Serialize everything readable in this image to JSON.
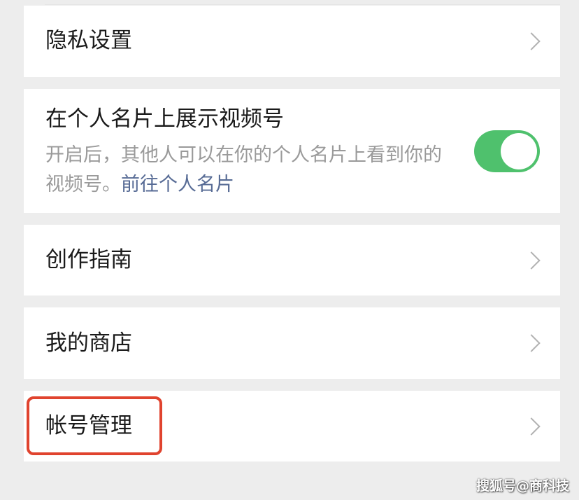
{
  "settings": {
    "privacy": {
      "label": "隐私设置"
    },
    "show_on_card": {
      "label": "在个人名片上展示视频号",
      "description": "开启后，其他人可以在你的个人名片上看到你的视频号。",
      "link": "前往个人名片",
      "enabled": true
    },
    "creation_guide": {
      "label": "创作指南"
    },
    "my_store": {
      "label": "我的商店"
    },
    "account_management": {
      "label": "帐号管理"
    }
  },
  "watermark": "搜狐号@商科技",
  "colors": {
    "toggle_on": "#4fc16d",
    "link": "#576b95",
    "highlight": "#e0432e",
    "background": "#ededed"
  }
}
